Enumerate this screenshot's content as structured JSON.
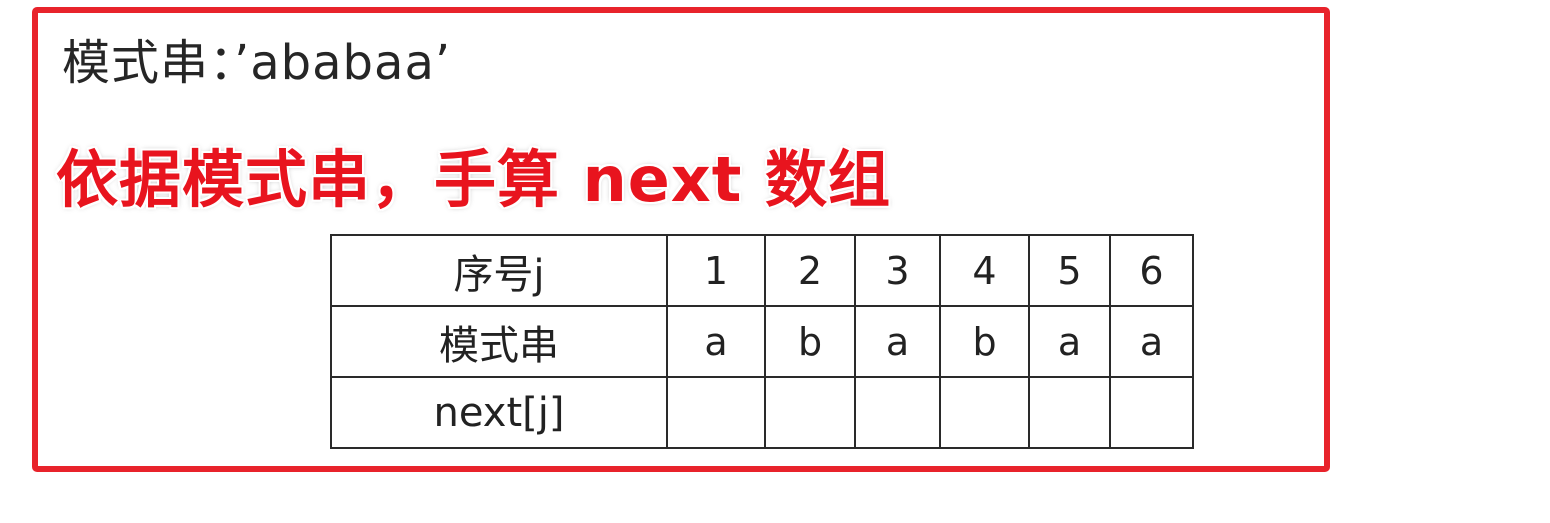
{
  "header": {
    "pattern_label": "模式串：’ababaa’"
  },
  "instruction": "依据模式串，手算 next 数组",
  "table": {
    "rows": [
      {
        "label": "序号j",
        "cells": [
          "1",
          "2",
          "3",
          "4",
          "5",
          "6"
        ]
      },
      {
        "label": "模式串",
        "cells": [
          "a",
          "b",
          "a",
          "b",
          "a",
          "a"
        ]
      },
      {
        "label": "next[j]",
        "cells": [
          "",
          "",
          "",
          "",
          "",
          ""
        ]
      }
    ]
  },
  "colors": {
    "frame_border": "#e8232b",
    "instruction_text": "#e8141e",
    "body_text": "#262626"
  }
}
